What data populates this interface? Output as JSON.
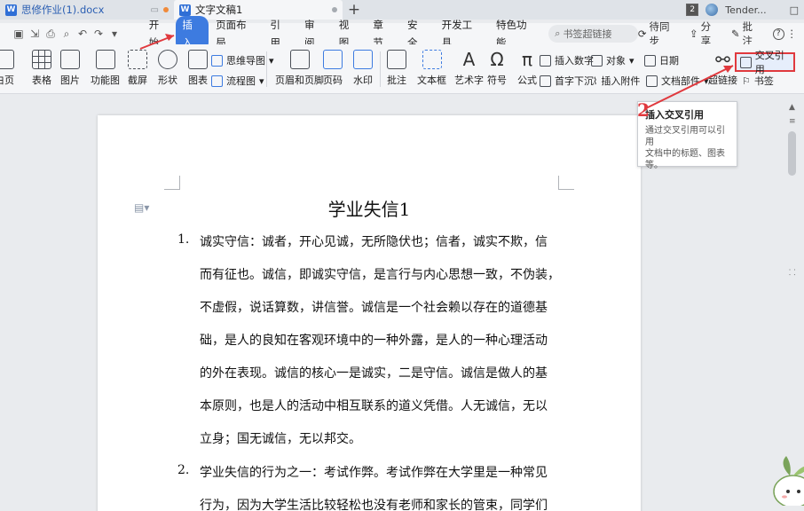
{
  "titlebar": {
    "tabs": [
      {
        "label": "思修作业(1).docx",
        "active": false
      },
      {
        "label": "文字文稿1",
        "active": true
      }
    ],
    "new_tab": "+",
    "badge_count": "2",
    "user": "Tender...",
    "window_icon": "□"
  },
  "menubar": {
    "items": [
      "开始",
      "插入",
      "页面布局",
      "引用",
      "审阅",
      "视图",
      "章节",
      "安全",
      "开发工具",
      "特色功能"
    ],
    "active_item": "插入",
    "search_placeholder": "书签超链接",
    "right": {
      "sync": "待同步",
      "share": "分享",
      "comment": "批注",
      "help": "?"
    }
  },
  "ribbon": {
    "page": "白页",
    "table": "表格",
    "picture": "图片",
    "function_chart": "功能图",
    "screenshot": "截屏",
    "shape": "形状",
    "chart": "图表",
    "mindmap": "思维导图",
    "flowchart": "流程图",
    "header_footer": "页眉和页脚",
    "page_number": "页码",
    "watermark": "水印",
    "comment": "批注",
    "textbox": "文本框",
    "wordart": "艺术字",
    "symbol": "符号",
    "formula": "公式",
    "insert_number": "插入数字",
    "object": "对象",
    "date": "日期",
    "drop_cap": "首字下沉",
    "insert_attachment": "插入附件",
    "doc_parts": "文档部件",
    "hyperlink": "超链接",
    "cross_ref": "交叉引用",
    "bookmark": "书签"
  },
  "tooltip": {
    "title": "插入交叉引用",
    "body": [
      "通过交叉引用可以引用",
      "文档中的标题、图表",
      "等。"
    ]
  },
  "steps": {
    "two": "2"
  },
  "document": {
    "title": "学业失信1",
    "items": [
      {
        "num": "1.",
        "lines": [
          "诚实守信：诚者，开心见诚，无所隐伏也；信者，诚实不欺，信",
          "而有征也。诚信，即诚实守信，是言行与内心思想一致，不伪装，",
          "不虚假，说话算数，讲信誉。诚信是一个社会赖以存在的道德基",
          "础，是人的良知在客观环境中的一种外露，是人的一种心理活动",
          "的外在表现。诚信的核心一是诚实，二是守信。诚信是做人的基",
          "本原则，也是人的活动中相互联系的道义凭借。人无诚信，无以",
          "立身；国无诚信，无以邦交。"
        ]
      },
      {
        "num": "2.",
        "lines": [
          "学业失信的行为之一：考试作弊。考试作弊在大学里是一种常见",
          "行为，因为大学生活比较轻松也没有老师和家长的管束，同学们"
        ]
      }
    ]
  },
  "colors": {
    "accent": "#3d7be0",
    "annotation": "#e0393e"
  }
}
